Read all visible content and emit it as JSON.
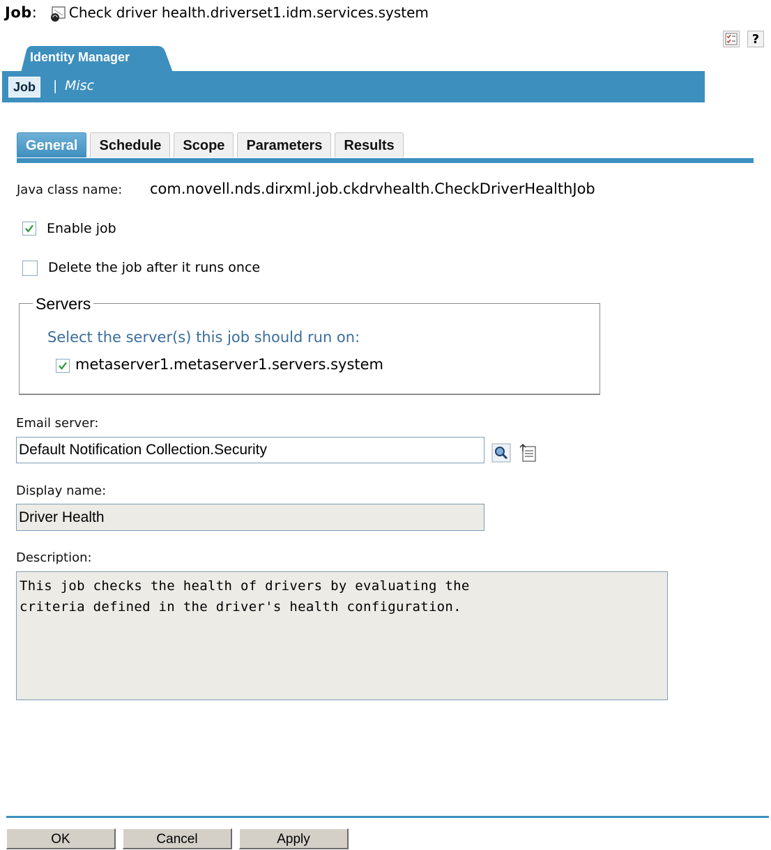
{
  "header": {
    "title_label": "Job",
    "title_sep": ":",
    "job_path": "Check driver health.driverset1.idm.services.system"
  },
  "toolbar": {
    "help_label": "?"
  },
  "nav": {
    "section_tab": "Identity Manager",
    "links": [
      {
        "label": "Job",
        "active": true
      },
      {
        "label": "Misc",
        "active": false
      }
    ],
    "separator": "|"
  },
  "tabs": [
    {
      "label": "General",
      "active": true
    },
    {
      "label": "Schedule",
      "active": false
    },
    {
      "label": "Scope",
      "active": false
    },
    {
      "label": "Parameters",
      "active": false
    },
    {
      "label": "Results",
      "active": false
    }
  ],
  "general": {
    "java_class_label": "Java class name:",
    "java_class_value": "com.novell.nds.dirxml.job.ckdrvhealth.CheckDriverHealthJob",
    "enable_job": {
      "label": "Enable job",
      "checked": true
    },
    "delete_after_run": {
      "label": "Delete the job after it runs once",
      "checked": false
    },
    "servers": {
      "legend": "Servers",
      "prompt": "Select the server(s) this job should run on:",
      "items": [
        {
          "label": "metaserver1.metaserver1.servers.system",
          "checked": true
        }
      ]
    },
    "email_server": {
      "label": "Email server:",
      "value": "Default Notification Collection.Security"
    },
    "display_name": {
      "label": "Display name:",
      "value": "Driver Health"
    },
    "description": {
      "label": "Description:",
      "value": "This job checks the health of drivers by evaluating the\ncriteria defined in the driver's health configuration."
    }
  },
  "buttons": {
    "ok": "OK",
    "cancel": "Cancel",
    "apply": "Apply"
  },
  "colors": {
    "accent_blue": "#3d8fbe",
    "checkbox_check": "#1e9a2c",
    "prompt_text": "#3a6e9c"
  }
}
